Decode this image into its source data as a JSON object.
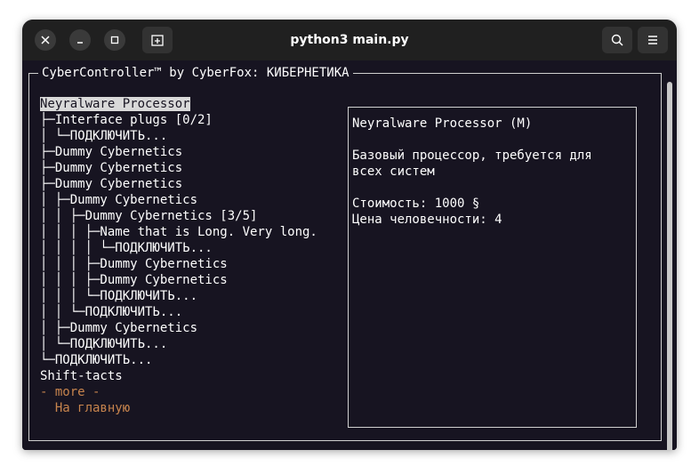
{
  "window": {
    "title": "python3 main.py"
  },
  "terminal": {
    "frame_title": "CyberController™ by CyberFox: КИБЕРНЕТИКА",
    "tree": [
      {
        "text": "Neyralware Processor",
        "selected": true
      },
      {
        "text": "├─Interface plugs [0/2]"
      },
      {
        "text": "│ └─ПОДКЛЮЧИТЬ..."
      },
      {
        "text": "├─Dummy Cybernetics"
      },
      {
        "text": "├─Dummy Cybernetics"
      },
      {
        "text": "├─Dummy Cybernetics"
      },
      {
        "text": "│ ├─Dummy Cybernetics"
      },
      {
        "text": "│ │ ├─Dummy Cybernetics [3/5]"
      },
      {
        "text": "│ │ │ ├─Name that is Long. Very long."
      },
      {
        "text": "│ │ │ │ └─ПОДКЛЮЧИТЬ..."
      },
      {
        "text": "│ │ │ ├─Dummy Cybernetics"
      },
      {
        "text": "│ │ │ ├─Dummy Cybernetics"
      },
      {
        "text": "│ │ │ └─ПОДКЛЮЧИТЬ..."
      },
      {
        "text": "│ │ └─ПОДКЛЮЧИТЬ..."
      },
      {
        "text": "│ ├─Dummy Cybernetics"
      },
      {
        "text": "│ └─ПОДКЛЮЧИТЬ..."
      },
      {
        "text": "└─ПОДКЛЮЧИТЬ..."
      },
      {
        "text": "Shift-tacts"
      },
      {
        "text": "- more -",
        "accent": true
      },
      {
        "text": "  На главную",
        "accent": true
      }
    ],
    "detail": {
      "lines": [
        "Neyralware Processor (M)",
        "",
        "Базовый процессор, требуется для",
        "всех систем",
        "",
        "Стоимость: 1000 §",
        "Цена человечности: 4"
      ]
    }
  },
  "icons": {
    "close": "close-icon",
    "minimize": "minimize-icon",
    "maximize": "maximize-icon",
    "new_tab": "new-tab-icon",
    "search": "search-icon",
    "menu": "hamburger-menu-icon"
  },
  "colors": {
    "background": "#171421",
    "accent": "#c7844d",
    "titlebar": "#202020"
  }
}
